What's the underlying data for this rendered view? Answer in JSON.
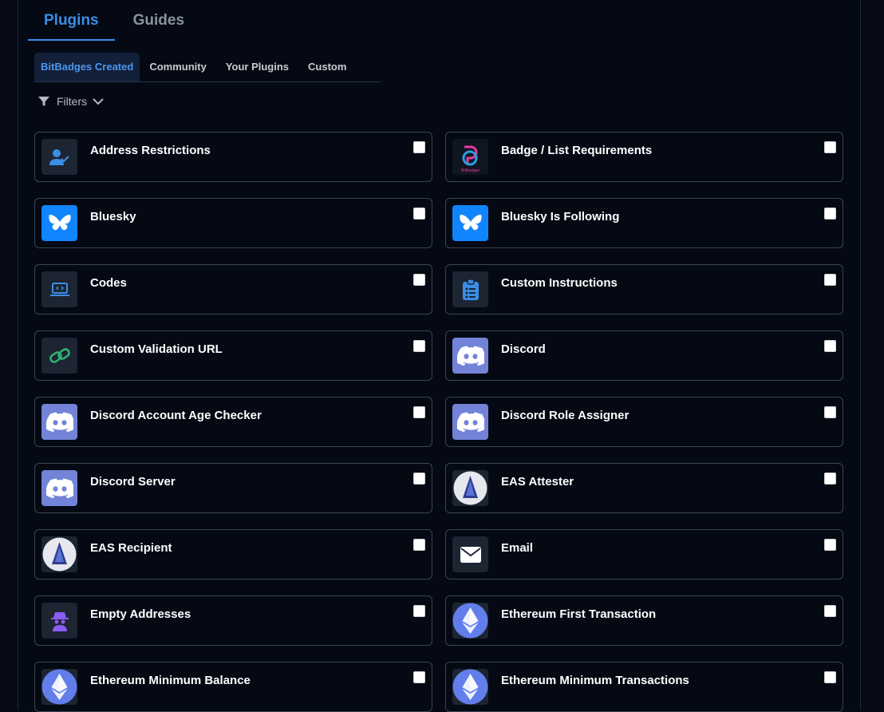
{
  "main_tabs": [
    {
      "label": "Plugins",
      "active": true
    },
    {
      "label": "Guides",
      "active": false
    }
  ],
  "sub_tabs": [
    {
      "label": "BitBadges Created",
      "active": true
    },
    {
      "label": "Community",
      "active": false
    },
    {
      "label": "Your Plugins",
      "active": false
    },
    {
      "label": "Custom",
      "active": false
    }
  ],
  "filters": {
    "label": "Filters"
  },
  "plugins": [
    {
      "title": "Address Restrictions",
      "icon": "user-check-icon",
      "checked": false
    },
    {
      "title": "Badge / List Requirements",
      "icon": "bitbadges-logo-icon",
      "logo_text": "BitBadges",
      "checked": false
    },
    {
      "title": "Bluesky",
      "icon": "bluesky-butterfly-icon",
      "checked": false
    },
    {
      "title": "Bluesky Is Following",
      "icon": "bluesky-butterfly-icon",
      "checked": false
    },
    {
      "title": "Codes",
      "icon": "laptop-code-icon",
      "checked": false
    },
    {
      "title": "Custom Instructions",
      "icon": "clipboard-list-icon",
      "checked": false
    },
    {
      "title": "Custom Validation URL",
      "icon": "link-icon",
      "checked": false
    },
    {
      "title": "Discord",
      "icon": "discord-icon",
      "checked": false
    },
    {
      "title": "Discord Account Age Checker",
      "icon": "discord-icon",
      "checked": false
    },
    {
      "title": "Discord Role Assigner",
      "icon": "discord-icon",
      "checked": false
    },
    {
      "title": "Discord Server",
      "icon": "discord-icon",
      "checked": false
    },
    {
      "title": "EAS Attester",
      "icon": "eas-logo-icon",
      "checked": false
    },
    {
      "title": "EAS Recipient",
      "icon": "eas-logo-icon",
      "checked": false
    },
    {
      "title": "Email",
      "icon": "envelope-icon",
      "checked": false
    },
    {
      "title": "Empty Addresses",
      "icon": "spy-icon",
      "checked": false
    },
    {
      "title": "Ethereum First Transaction",
      "icon": "ethereum-icon",
      "checked": false
    },
    {
      "title": "Ethereum Minimum Balance",
      "icon": "ethereum-icon",
      "checked": false
    },
    {
      "title": "Ethereum Minimum Transactions",
      "icon": "ethereum-icon",
      "checked": false
    }
  ],
  "colors": {
    "background": "#050a16",
    "accent": "#3a8ee6",
    "card_border": "#3b4552",
    "bluesky": "#1185fe",
    "discord": "#7283d8",
    "ethereum": "#627eea"
  }
}
